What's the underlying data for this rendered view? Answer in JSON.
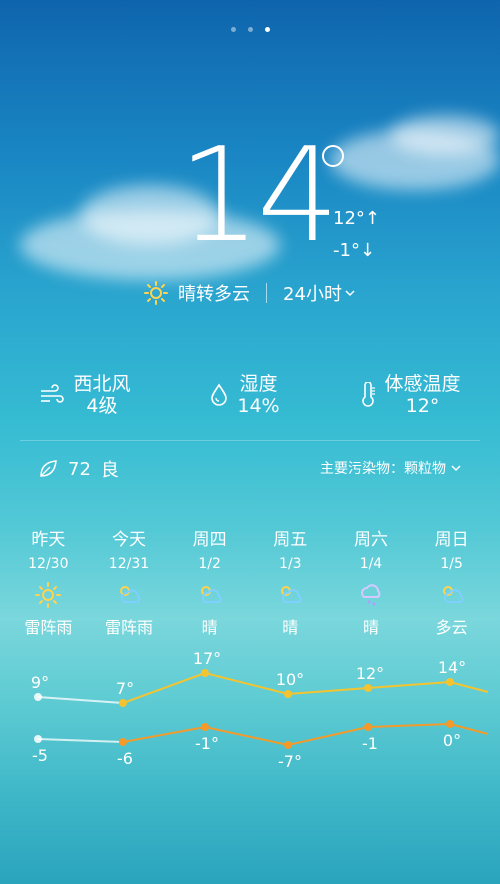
{
  "pager": {
    "pages": 3,
    "active": 2
  },
  "current": {
    "temperature": "14",
    "high": "12°↑",
    "low": "-1°↓",
    "condition": "晴转多云",
    "hourly_label": "24小时"
  },
  "stats": {
    "wind": {
      "label": "西北风",
      "value": "4级",
      "icon": "wind-icon"
    },
    "humidity": {
      "label": "湿度",
      "value": "14%",
      "icon": "drop-icon"
    },
    "feels": {
      "label": "体感温度",
      "value": "12°",
      "icon": "thermometer-icon"
    }
  },
  "aqi": {
    "value": "72",
    "level": "良",
    "pollutant": "主要污染物：颗粒物"
  },
  "days": [
    {
      "name": "昨天",
      "date": "12/30",
      "cond": "雷阵雨",
      "icon": "sun-icon"
    },
    {
      "name": "今天",
      "date": "12/31",
      "cond": "雷阵雨",
      "icon": "partly-cloudy-icon"
    },
    {
      "name": "周四",
      "date": "1/2",
      "cond": "晴",
      "icon": "partly-cloudy-icon"
    },
    {
      "name": "周五",
      "date": "1/3",
      "cond": "晴",
      "icon": "partly-cloudy-icon"
    },
    {
      "name": "周六",
      "date": "1/4",
      "cond": "晴",
      "icon": "snow-cloud-icon"
    },
    {
      "name": "周日",
      "date": "1/5",
      "cond": "多云",
      "icon": "partly-cloudy-icon"
    }
  ],
  "chart_data": {
    "type": "line",
    "categories": [
      "昨天",
      "今天",
      "周四",
      "周五",
      "周六",
      "周日"
    ],
    "series": [
      {
        "values": [
          9,
          7,
          17,
          10,
          12,
          14
        ],
        "labels": [
          "9°",
          "7°",
          "17°",
          "10°",
          "12°",
          "14°"
        ],
        "color": "#f4c430"
      },
      {
        "values": [
          -5,
          -6,
          -1,
          -7,
          -1,
          0
        ],
        "labels": [
          "-5",
          "-6",
          "-1°",
          "-7°",
          "-1",
          "0°"
        ],
        "color": "#f39a2a"
      }
    ]
  }
}
